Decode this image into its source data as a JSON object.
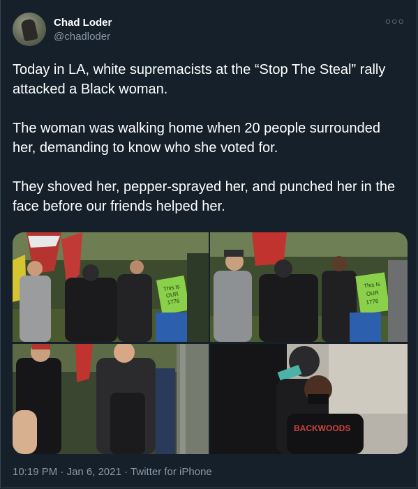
{
  "tweet": {
    "display_name": "Chad Loder",
    "handle": "@chadloder",
    "text": "Today in LA, white supremacists at the “Stop The Steal” rally attacked a Black woman.\n\nThe woman was walking home when 20 people surrounded her, demanding to know who she voted for.\n\nThey shoved her, pepper-sprayed her, and punched her in the face before our friends helped her.",
    "more_icon": "more-icon",
    "time": "10:19 PM",
    "separator": "·",
    "date": "Jan 6, 2021",
    "source": "Twitter for iPhone"
  },
  "media": {
    "sign_text": [
      "This Is",
      "OUR",
      "1776"
    ],
    "shirt_text": "BACKWOODS",
    "photos": [
      {
        "label": "photo-1"
      },
      {
        "label": "photo-2"
      },
      {
        "label": "photo-3"
      },
      {
        "label": "photo-4"
      }
    ]
  },
  "colors": {
    "background": "#15202b",
    "secondary_text": "#8899a6",
    "border": "#38444d"
  }
}
